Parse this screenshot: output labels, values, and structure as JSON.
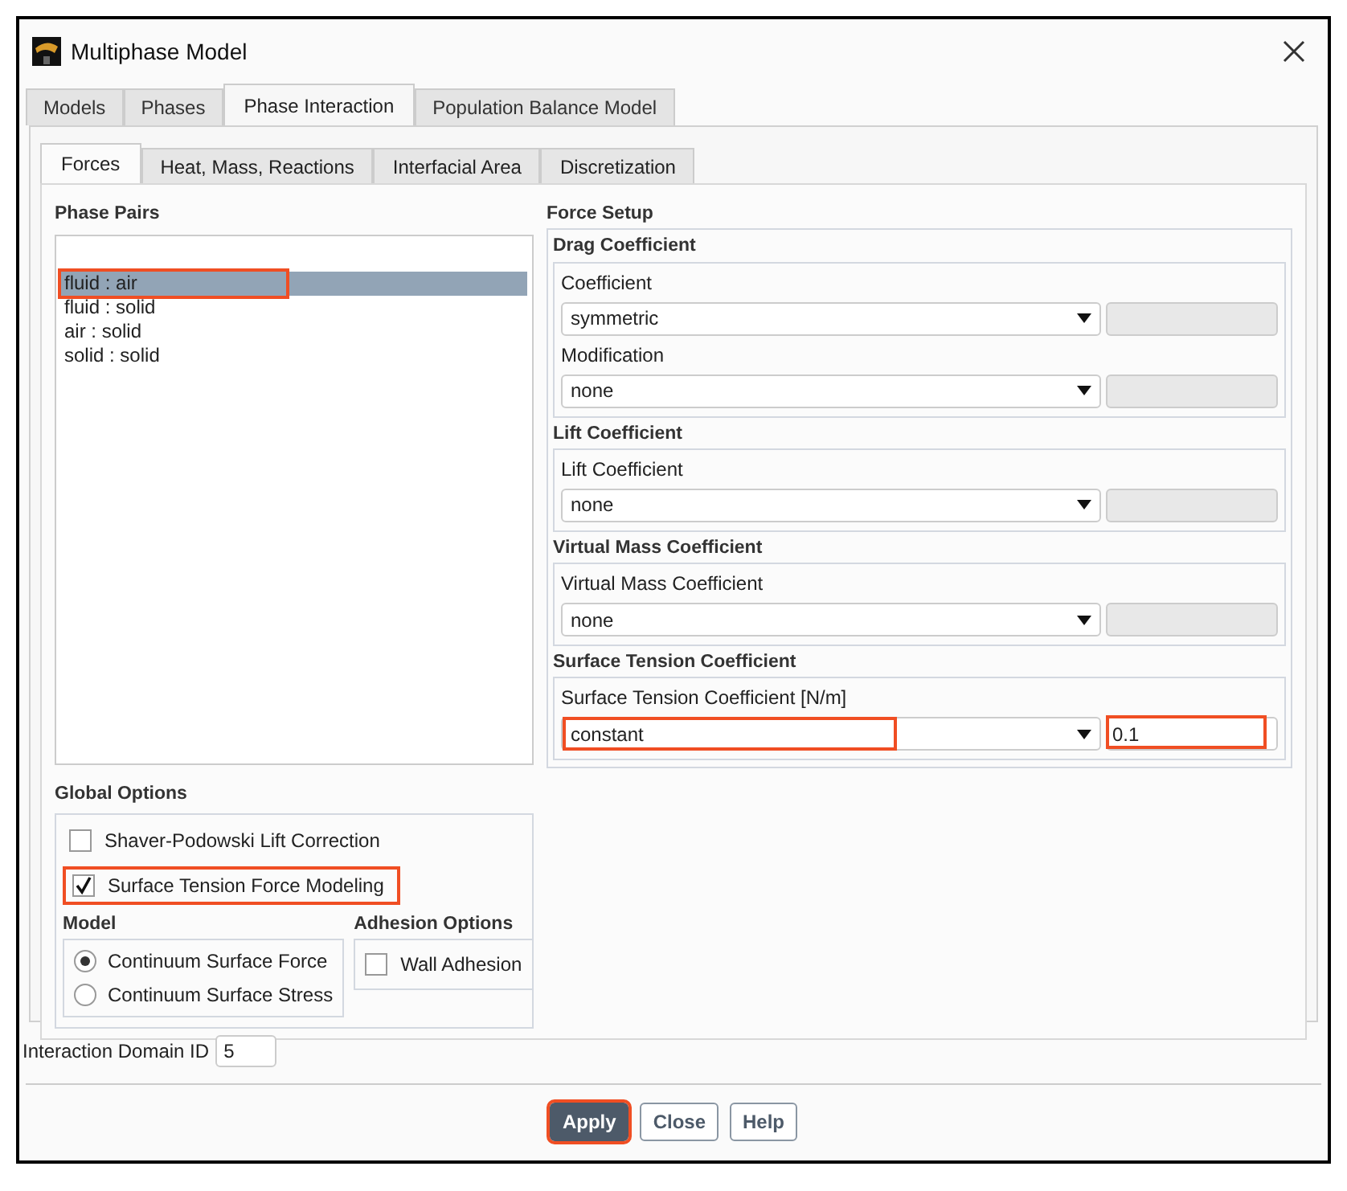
{
  "window": {
    "title": "Multiphase Model"
  },
  "tabs": [
    {
      "label": "Models",
      "selected": false
    },
    {
      "label": "Phases",
      "selected": false
    },
    {
      "label": "Phase Interaction",
      "selected": true
    },
    {
      "label": "Population Balance Model",
      "selected": false
    }
  ],
  "subtabs": [
    {
      "label": "Forces",
      "selected": true
    },
    {
      "label": "Heat, Mass, Reactions",
      "selected": false
    },
    {
      "label": "Interfacial Area",
      "selected": false
    },
    {
      "label": "Discretization",
      "selected": false
    }
  ],
  "phase_pairs": {
    "title": "Phase Pairs",
    "items": [
      {
        "label": "fluid : air",
        "selected": true,
        "highlighted": true
      },
      {
        "label": "fluid : solid",
        "selected": false,
        "highlighted": false
      },
      {
        "label": "air : solid",
        "selected": false,
        "highlighted": false
      },
      {
        "label": "solid : solid",
        "selected": false,
        "highlighted": false
      }
    ]
  },
  "force_setup": {
    "title": "Force Setup",
    "groups": [
      {
        "title": "Drag Coefficient",
        "fields": [
          {
            "label": "Coefficient",
            "value": "symmetric",
            "disabled_input": true,
            "highlighted": false
          },
          {
            "label": "Modification",
            "value": "none",
            "disabled_input": true,
            "highlighted": false
          }
        ]
      },
      {
        "title": "Lift Coefficient",
        "fields": [
          {
            "label": "Lift Coefficient",
            "value": "none",
            "disabled_input": true,
            "highlighted": false
          }
        ]
      },
      {
        "title": "Virtual Mass Coefficient",
        "fields": [
          {
            "label": "Virtual Mass Coefficient",
            "value": "none",
            "disabled_input": true,
            "highlighted": false
          }
        ]
      },
      {
        "title": "Surface Tension Coefficient",
        "fields": [
          {
            "label": "Surface Tension Coefficient [N/m]",
            "value": "constant",
            "disabled_input": false,
            "input_value": "0.1",
            "highlighted": true
          }
        ]
      }
    ]
  },
  "global_options": {
    "title": "Global Options",
    "checkboxes": [
      {
        "label": "Shaver-Podowski Lift Correction",
        "checked": false,
        "highlighted": false
      },
      {
        "label": "Surface Tension Force Modeling",
        "checked": true,
        "highlighted": true
      }
    ],
    "model": {
      "title": "Model",
      "options": [
        {
          "label": "Continuum Surface Force",
          "selected": true
        },
        {
          "label": "Continuum Surface Stress",
          "selected": false
        }
      ]
    },
    "adhesion": {
      "title": "Adhesion Options",
      "checkboxes": [
        {
          "label": "Wall Adhesion",
          "checked": false
        }
      ]
    }
  },
  "interaction_domain": {
    "label": "Interaction Domain ID",
    "value": "5"
  },
  "buttons": [
    {
      "label": "Apply",
      "kind": "primary",
      "highlighted": true
    },
    {
      "label": "Close",
      "kind": "default",
      "highlighted": false
    },
    {
      "label": "Help",
      "kind": "default",
      "highlighted": false
    }
  ]
}
